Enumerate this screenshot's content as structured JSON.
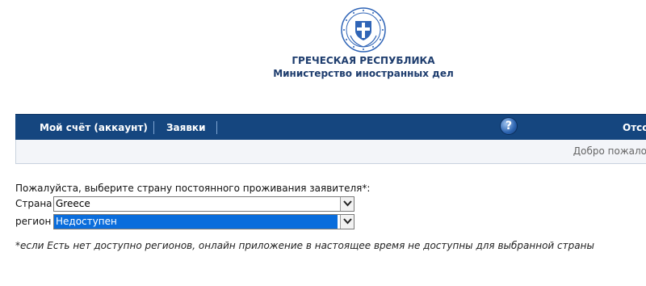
{
  "header": {
    "emblem_icon": "greek-state-emblem-icon",
    "title": "ГРЕЧЕСКАЯ РЕСПУБЛИКА",
    "subtitle": "Министерство иностранных дел"
  },
  "nav": {
    "items": [
      {
        "label": "Мой счёт (аккаунт)"
      },
      {
        "label": "Заявки"
      }
    ],
    "help_icon": "help-icon",
    "right_label": "Отсо"
  },
  "welcome": {
    "text": "Добро пожало"
  },
  "form": {
    "prompt": "Пожалуйста, выберите страну постоянного проживания заявителя*:",
    "country_label": "Страна",
    "country_value": "Greece",
    "region_label": "регион",
    "region_value": "Недоступен",
    "note": "*если Есть нет доступно регионов, онлайн приложение в настоящее время не доступны для выбранной страны"
  },
  "colors": {
    "navbar": "#15467f",
    "title_blue": "#1e3d6e",
    "selection_blue": "#0a6ddc"
  }
}
